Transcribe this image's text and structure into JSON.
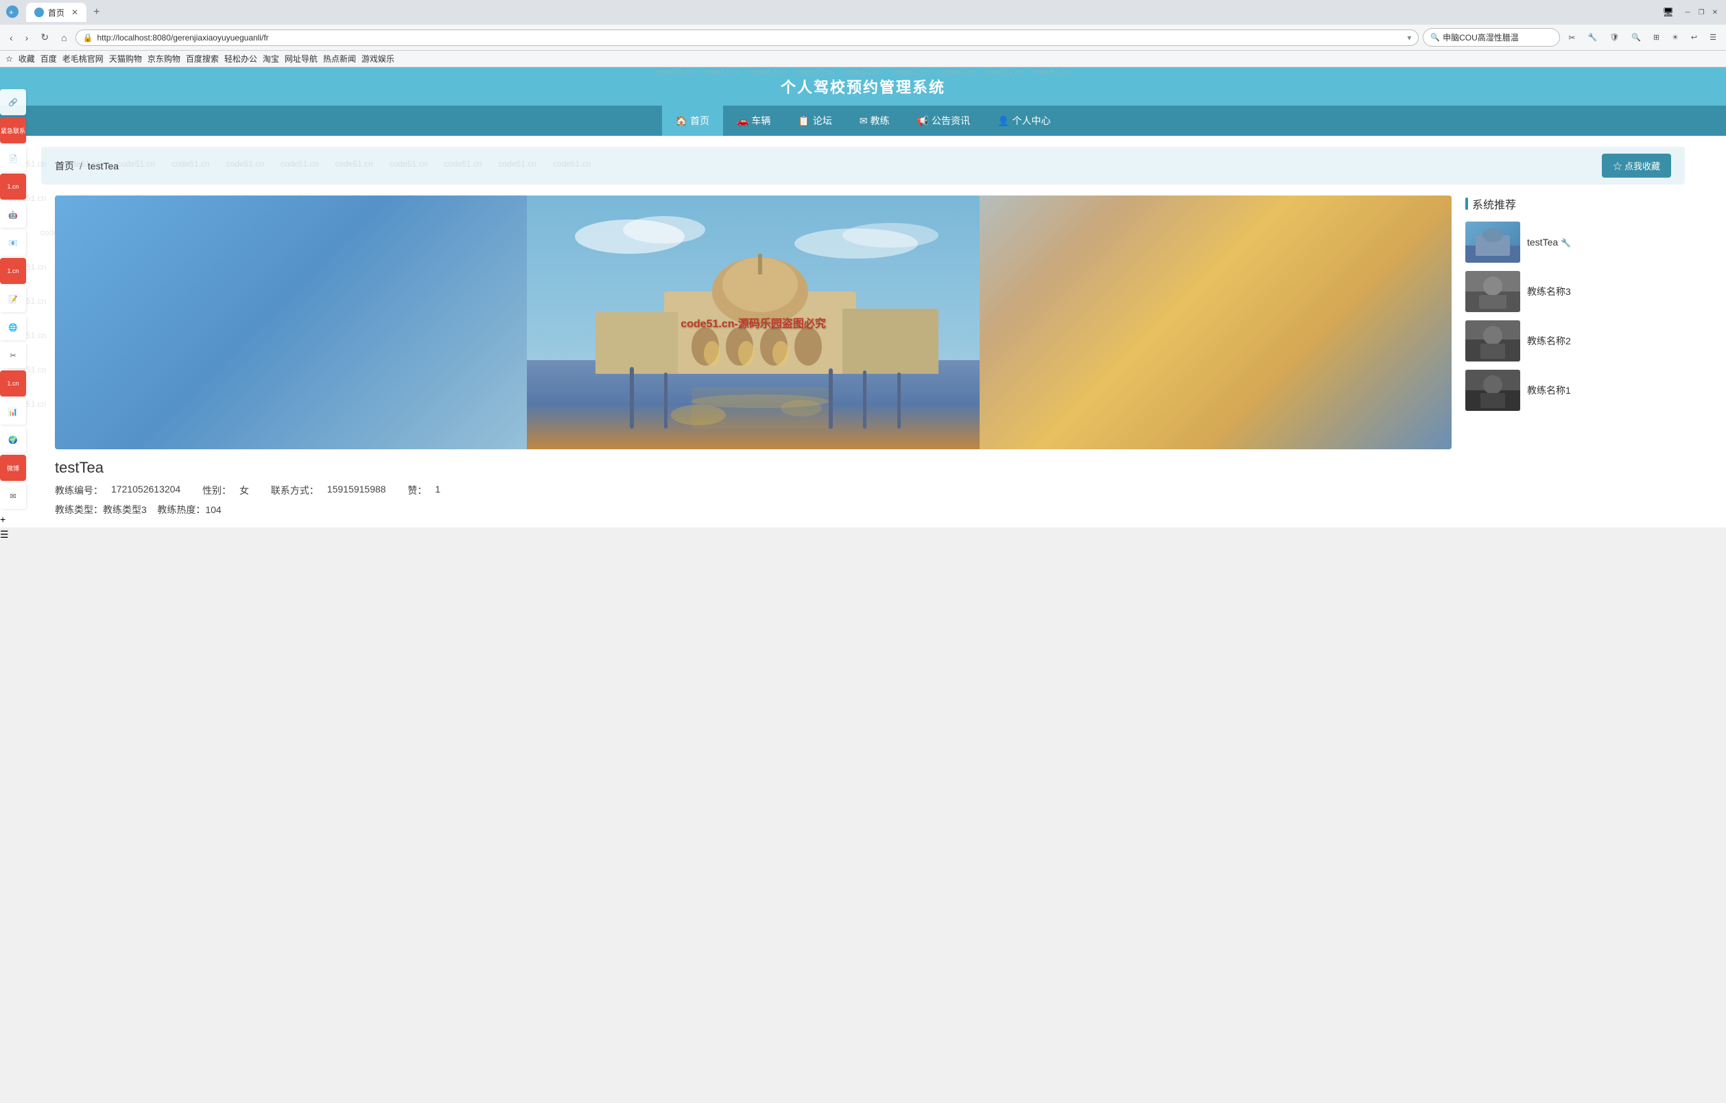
{
  "browser": {
    "tab_label": "首页",
    "url": "http://localhost:8080/gerenjiaxiaoyuyueguanli/fr",
    "search_placeholder": "申脑COU高湿性腊温",
    "new_tab_label": "+"
  },
  "bookmarks": [
    {
      "label": "收藏"
    },
    {
      "label": "百度"
    },
    {
      "label": "老毛桃官网"
    },
    {
      "label": "天猫购物"
    },
    {
      "label": "京东购物"
    },
    {
      "label": "百度搜索"
    },
    {
      "label": "轻松办公"
    },
    {
      "label": "淘宝"
    },
    {
      "label": "网址导航"
    },
    {
      "label": "热点新闻"
    },
    {
      "label": "游戏娱乐"
    }
  ],
  "site": {
    "title": "个人驾校预约管理系统",
    "nav": [
      {
        "label": "首页",
        "icon": "🏠",
        "active": true
      },
      {
        "label": "车辆",
        "icon": "🚗"
      },
      {
        "label": "论坛",
        "icon": "📋"
      },
      {
        "label": "教练",
        "icon": "✉"
      },
      {
        "label": "公告资讯",
        "icon": "📢"
      },
      {
        "label": "个人中心",
        "icon": "👤"
      }
    ]
  },
  "breadcrumb": {
    "home": "首页",
    "separator": "/",
    "current": "testTea"
  },
  "favorite_btn": "☆ 点我收藏",
  "coach": {
    "name": "testTea",
    "id_label": "教练编号：",
    "id_value": "1721052613204",
    "gender_label": "性别：",
    "gender_value": "女",
    "contact_label": "联系方式：",
    "contact_value": "15915915988",
    "likes_label": "赞：",
    "likes_value": "1",
    "type_label": "教练类型：",
    "type_value": "教练类型3",
    "heat_label": "教练热度：",
    "heat_value": "104",
    "image_watermark": "code51.cn-源码乐园盗图必究"
  },
  "recommendations": {
    "header": "系统推荐",
    "items": [
      {
        "name": "testTea",
        "has_icon": true
      },
      {
        "name": "教练名称3",
        "has_icon": false
      },
      {
        "name": "教练名称2",
        "has_icon": false
      },
      {
        "name": "教练名称1",
        "has_icon": false
      }
    ]
  },
  "watermark": {
    "text": "code51.cn"
  }
}
